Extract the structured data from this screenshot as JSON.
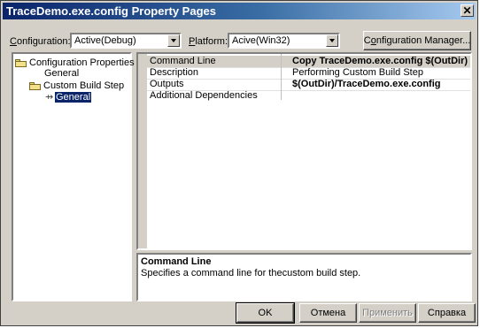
{
  "window": {
    "title": "TraceDemo.exe.config Property Pages"
  },
  "header": {
    "configuration_prefix": "C",
    "configuration_rest": "onfiguration:",
    "configuration_value": "Active(Debug)",
    "platform_prefix": "P",
    "platform_rest": "latform:",
    "platform_value": "Acive(Win32)",
    "config_manager_prefix": "C",
    "config_manager_mid": "o",
    "config_manager_rest": "nfiguration Manager..."
  },
  "tree": {
    "items": [
      {
        "label": "Configuration Properties",
        "icon": "folder-open-icon"
      },
      {
        "label": "General"
      },
      {
        "label": "Custom Build Step",
        "icon": "folder-open-icon"
      },
      {
        "label": "General",
        "icon": "property-page-icon",
        "selected": true
      }
    ]
  },
  "grid": {
    "rows": [
      {
        "name": "Command Line",
        "value": "Copy TraceDemo.exe.config $(OutDir)",
        "bold": true,
        "active": true
      },
      {
        "name": "Description",
        "value": "Performing Custom Build Step",
        "bold": false
      },
      {
        "name": "Outputs",
        "value": "$(OutDir)/TraceDemo.exe.config",
        "bold": true
      },
      {
        "name": "Additional Dependencies",
        "value": "",
        "bold": false
      }
    ]
  },
  "description": {
    "title": "Command Line",
    "text": "Specifies a command line for thecustom build step."
  },
  "buttons": {
    "ok": "OK",
    "cancel": "Отмена",
    "apply": "Применить",
    "help": "Справка"
  }
}
